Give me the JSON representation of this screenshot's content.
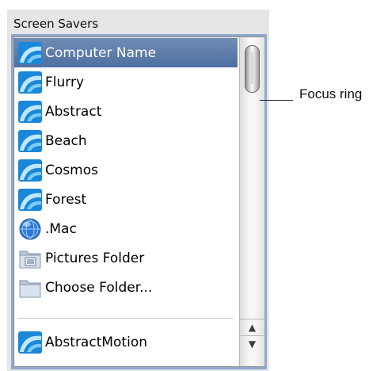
{
  "panel": {
    "title": "Screen Savers"
  },
  "list": {
    "items": [
      {
        "label": "Computer Name",
        "icon": "screensaver-swirl-icon",
        "selected": true
      },
      {
        "label": "Flurry",
        "icon": "screensaver-swirl-icon",
        "selected": false
      },
      {
        "label": "Abstract",
        "icon": "screensaver-swirl-icon",
        "selected": false
      },
      {
        "label": "Beach",
        "icon": "screensaver-swirl-icon",
        "selected": false
      },
      {
        "label": "Cosmos",
        "icon": "screensaver-swirl-icon",
        "selected": false
      },
      {
        "label": "Forest",
        "icon": "screensaver-swirl-icon",
        "selected": false
      },
      {
        "label": ".Mac",
        "icon": "mac-globe-icon",
        "selected": false
      },
      {
        "label": "Pictures Folder",
        "icon": "pictures-folder-icon",
        "selected": false
      },
      {
        "label": "Choose Folder...",
        "icon": "folder-icon",
        "selected": false
      },
      {
        "label": "AbstractMotion",
        "icon": "screensaver-swirl-icon",
        "selected": false
      }
    ]
  },
  "scrollbar": {
    "up_arrow": "▲",
    "down_arrow": "▼"
  },
  "callout": {
    "label": "Focus ring"
  },
  "colors": {
    "selection": "#5d7cab",
    "focus_ring": "#8fa9cc",
    "panel_bg": "#e6e6e6"
  }
}
